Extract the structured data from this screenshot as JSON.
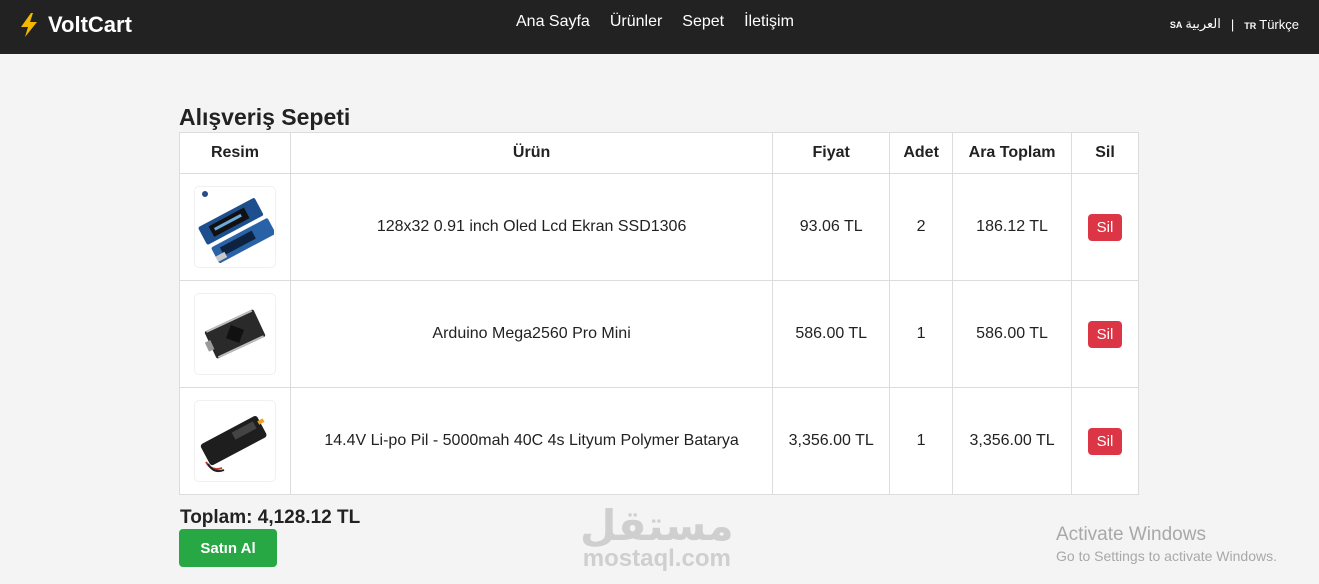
{
  "header": {
    "brand": "VoltCart",
    "nav": [
      "Ana Sayfa",
      "Ürünler",
      "Sepet",
      "İletişim"
    ],
    "languages": [
      {
        "code": "SA",
        "label": "العربية"
      },
      {
        "code": "TR",
        "label": "Türkçe"
      }
    ],
    "separator": "|"
  },
  "page": {
    "title": "Alışveriş Sepeti"
  },
  "table": {
    "headers": [
      "Resim",
      "Ürün",
      "Fiyat",
      "Adet",
      "Ara Toplam",
      "Sil"
    ],
    "rows": [
      {
        "product": "128x32 0.91 inch Oled Lcd Ekran SSD1306",
        "price": "93.06 TL",
        "qty": "2",
        "subtotal": "186.12 TL",
        "delete": "Sil",
        "image_icon": "oled-display-icon"
      },
      {
        "product": "Arduino Mega2560 Pro Mini",
        "price": "586.00 TL",
        "qty": "1",
        "subtotal": "586.00 TL",
        "delete": "Sil",
        "image_icon": "arduino-board-icon"
      },
      {
        "product": "14.4V Li-po Pil - 5000mah 40C 4s Lityum Polymer Batarya",
        "price": "3,356.00 TL",
        "qty": "1",
        "subtotal": "3,356.00 TL",
        "delete": "Sil",
        "image_icon": "lipo-battery-icon"
      }
    ]
  },
  "summary": {
    "total": "Toplam: 4,128.12 TL",
    "buy": "Satın Al"
  },
  "watermark": {
    "arabic": "مستقل",
    "latin": "mostaql.com"
  },
  "os_notice": {
    "line1": "Activate Windows",
    "line2": "Go to Settings to activate Windows."
  },
  "colors": {
    "navbar": "#222222",
    "delete": "#dc3545",
    "buy": "#28a745",
    "brand_bolt": "#f5b800"
  }
}
